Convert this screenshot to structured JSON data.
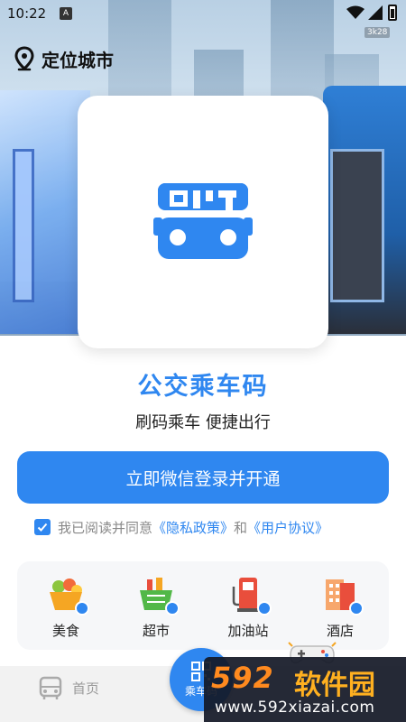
{
  "status_bar": {
    "time": "10:22",
    "notification_badge": "A",
    "network_speed": "3k28"
  },
  "location": {
    "label": "定位城市",
    "icon": "location-pin-icon"
  },
  "app": {
    "title": "公交乘车码",
    "subtitle": "刷码乘车 便捷出行",
    "logo_icon": "bus-qr-icon"
  },
  "login": {
    "button_label": "立即微信登录并开通"
  },
  "agreement": {
    "checked": true,
    "prefix": "我已阅读并同意",
    "privacy_link": "《隐私政策》",
    "conjunction": "和",
    "user_link": "《用户协议》"
  },
  "services": [
    {
      "label": "美食",
      "icon": "food-basket-icon"
    },
    {
      "label": "超市",
      "icon": "supermarket-basket-icon"
    },
    {
      "label": "加油站",
      "icon": "gas-station-icon"
    },
    {
      "label": "酒店",
      "icon": "hotel-building-icon"
    }
  ],
  "bottom_nav": {
    "home_label": "首页",
    "ride_label": "乘车码"
  },
  "watermark": {
    "brand_num": "592",
    "brand_cn": "软件园",
    "url": "www.592xiazai.com"
  },
  "colors": {
    "accent": "#2f87f0",
    "watermark_orange": "#ff8a1f"
  }
}
